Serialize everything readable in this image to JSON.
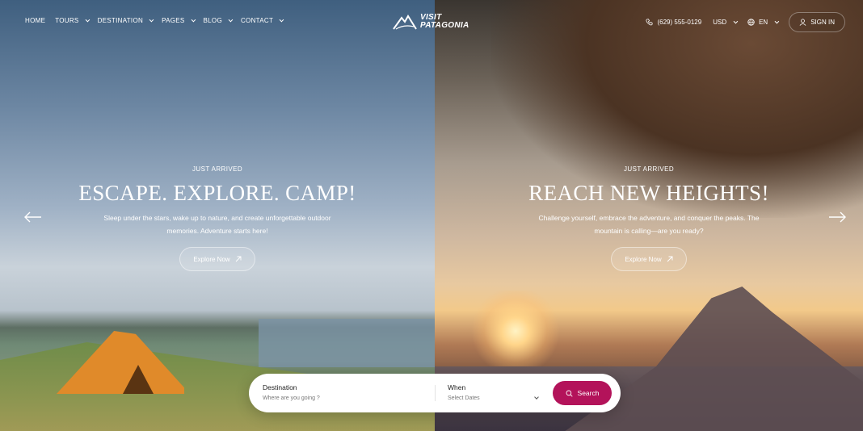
{
  "nav": {
    "items": [
      {
        "label": "HOME",
        "has_dropdown": false
      },
      {
        "label": "TOURS",
        "has_dropdown": true
      },
      {
        "label": "DESTINATION",
        "has_dropdown": true
      },
      {
        "label": "PAGES",
        "has_dropdown": true
      },
      {
        "label": "BLOG",
        "has_dropdown": true
      },
      {
        "label": "CONTACT",
        "has_dropdown": true
      }
    ],
    "logo": {
      "line1": "VISIT",
      "line2": "PATAGONIA"
    },
    "phone": "(629) 555-0129",
    "currency": "USD",
    "language": "EN",
    "signin": "SIGN IN"
  },
  "slides": [
    {
      "eyebrow": "JUST ARRIVED",
      "headline": "ESCAPE. EXPLORE. CAMP!",
      "description": "Sleep under the stars, wake up to nature, and create unforgettable outdoor memories. Adventure starts here!",
      "cta": "Explore Now"
    },
    {
      "eyebrow": "JUST ARRIVED",
      "headline": "REACH NEW HEIGHTS!",
      "description": "Challenge yourself, embrace the adventure, and conquer the peaks. The mountain is calling—are you ready?",
      "cta": "Explore Now"
    }
  ],
  "search": {
    "destination_label": "Destination",
    "destination_placeholder": "Where are you going ?",
    "when_label": "When",
    "when_placeholder": "Select Dates",
    "button": "Search"
  },
  "colors": {
    "accent": "#b3135a",
    "text": "#ffffff"
  },
  "icons": {
    "prev": "arrow-left-icon",
    "next": "arrow-right-icon",
    "phone": "phone-icon",
    "globe": "globe-icon",
    "user": "user-icon",
    "search": "search-icon",
    "external": "arrow-up-right-icon"
  }
}
